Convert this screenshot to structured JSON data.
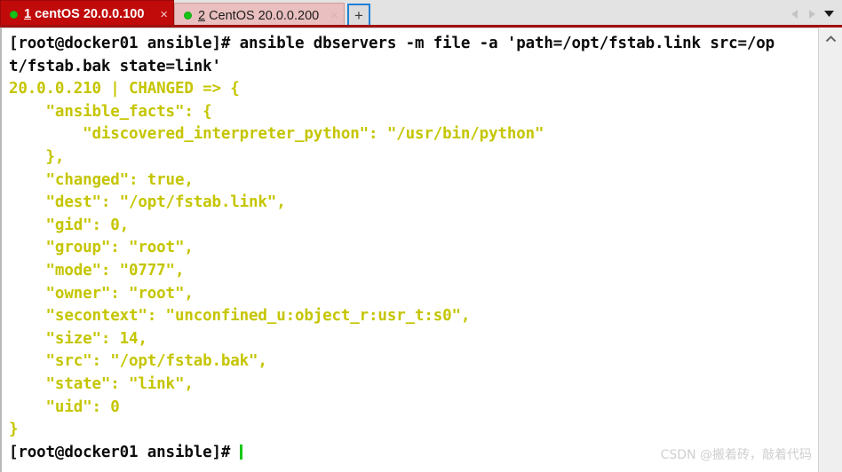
{
  "window": {
    "accent_red": "#c10a0a",
    "tabbar_underline": "#a01010",
    "terminal_bg": "#ffffff",
    "prompt_color": "#0b0b0b",
    "output_color": "#c5c500",
    "cursor_color": "#18c718"
  },
  "tabbar": {
    "tabs": [
      {
        "index": "1",
        "title": "centOS 20.0.0.100",
        "status_dot": "green-dot-icon",
        "close_label": "×",
        "active": true
      },
      {
        "index": "2",
        "title": "CentOS 20.0.0.200",
        "status_dot": "green-dot-icon",
        "close_label": "×",
        "active": false
      }
    ],
    "new_tab_label": "+",
    "scroll_left_icon": "chevron-left-icon",
    "scroll_right_icon": "chevron-right-icon",
    "tab_menu_icon": "caret-down-icon"
  },
  "terminal": {
    "lines": [
      {
        "text": "[root@docker01 ansible]# ansible dbservers -m file -a 'path=/opt/fstab.link src=/op",
        "color": "white"
      },
      {
        "text": "t/fstab.bak state=link'",
        "color": "white"
      },
      {
        "text": "20.0.0.210 | CHANGED => {",
        "color": "yellow"
      },
      {
        "text": "    \"ansible_facts\": {",
        "color": "yellow"
      },
      {
        "text": "        \"discovered_interpreter_python\": \"/usr/bin/python\"",
        "color": "yellow"
      },
      {
        "text": "    },",
        "color": "yellow"
      },
      {
        "text": "    \"changed\": true,",
        "color": "yellow"
      },
      {
        "text": "    \"dest\": \"/opt/fstab.link\",",
        "color": "yellow"
      },
      {
        "text": "    \"gid\": 0,",
        "color": "yellow"
      },
      {
        "text": "    \"group\": \"root\",",
        "color": "yellow"
      },
      {
        "text": "    \"mode\": \"0777\",",
        "color": "yellow"
      },
      {
        "text": "    \"owner\": \"root\",",
        "color": "yellow"
      },
      {
        "text": "    \"secontext\": \"unconfined_u:object_r:usr_t:s0\",",
        "color": "yellow"
      },
      {
        "text": "    \"size\": 14,",
        "color": "yellow"
      },
      {
        "text": "    \"src\": \"/opt/fstab.bak\",",
        "color": "yellow"
      },
      {
        "text": "    \"state\": \"link\",",
        "color": "yellow"
      },
      {
        "text": "    \"uid\": 0",
        "color": "yellow"
      },
      {
        "text": "}",
        "color": "yellow"
      }
    ],
    "prompt": "[root@docker01 ansible]# "
  },
  "scrollbar": {
    "up_arrow_icon": "chevron-up-icon"
  },
  "watermark": {
    "text": "CSDN @搬着砖，敲着代码"
  }
}
